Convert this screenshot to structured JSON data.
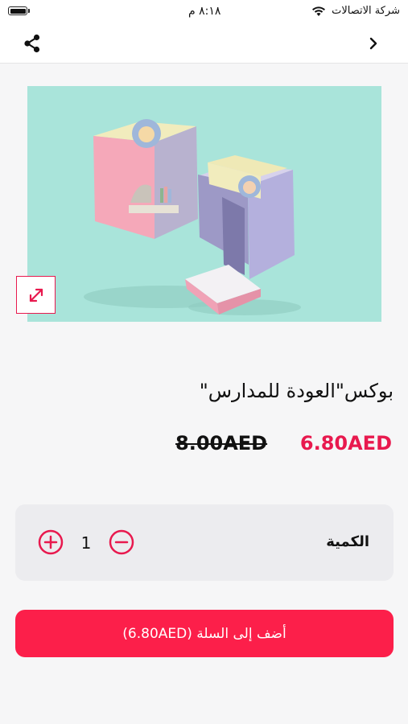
{
  "status_bar": {
    "carrier": "شركة الاتصالات",
    "time": "٨:١٨ م"
  },
  "product": {
    "title": "بوكس\"العودة للمدارس\"",
    "price_current": "6.80AED",
    "price_original": "8.00AED"
  },
  "quantity": {
    "label": "الكمية",
    "value": "1"
  },
  "cart": {
    "add_label": "أضف إلى السلة (6.80AED)"
  },
  "colors": {
    "accent": "#fc1f4a",
    "image_background": "#a9e4da"
  },
  "icons": {
    "share": "share-icon",
    "back": "chevron-right-icon",
    "expand": "expand-icon",
    "minus": "minus-circle-icon",
    "plus": "plus-circle-icon"
  }
}
